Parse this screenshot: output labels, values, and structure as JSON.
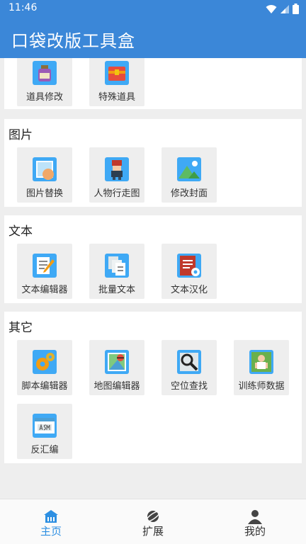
{
  "status": {
    "time": "11:46"
  },
  "app": {
    "title": "口袋改版工具盒"
  },
  "sections": [
    {
      "title": "",
      "items": [
        "道具修改",
        "特殊道具"
      ]
    },
    {
      "title": "图片",
      "items": [
        "图片替换",
        "人物行走图",
        "修改封面"
      ]
    },
    {
      "title": "文本",
      "items": [
        "文本编辑器",
        "批量文本",
        "文本汉化"
      ]
    },
    {
      "title": "其它",
      "items": [
        "脚本编辑器",
        "地图编辑器",
        "空位查找",
        "训练师数据",
        "反汇编"
      ]
    }
  ],
  "nav": [
    {
      "label": "主页",
      "icon": "home-icon",
      "active": true
    },
    {
      "label": "扩展",
      "icon": "planet-icon",
      "active": false
    },
    {
      "label": "我的",
      "icon": "person-icon",
      "active": false
    }
  ],
  "colors": {
    "primary": "#3b87d8",
    "active": "#2d8fe2",
    "background": "#eeeeee"
  }
}
